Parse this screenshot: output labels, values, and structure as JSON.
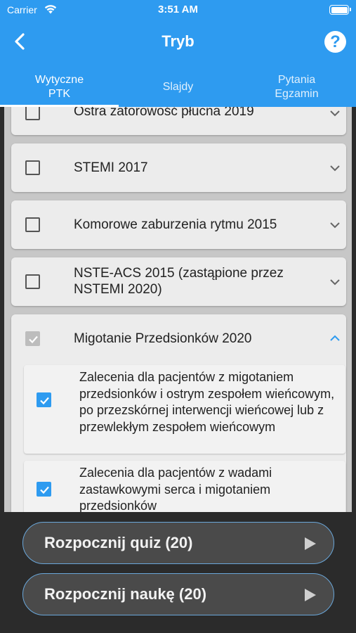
{
  "status": {
    "carrier": "Carrier",
    "time": "3:51 AM"
  },
  "nav": {
    "title": "Tryb",
    "help_label": "?"
  },
  "tabs": [
    {
      "label": "Wytyczne\nPTK",
      "active": true
    },
    {
      "label": "Slajdy",
      "active": false
    },
    {
      "label": "Pytania\nEgzamin",
      "active": false
    }
  ],
  "guidelines": [
    {
      "label": "Ostra zatorowość płucna 2019",
      "checked": false,
      "expanded": false
    },
    {
      "label": "STEMI 2017",
      "checked": false,
      "expanded": false
    },
    {
      "label": "Komorowe zaburzenia rytmu 2015",
      "checked": false,
      "expanded": false
    },
    {
      "label": "NSTE-ACS 2015 (zastąpione przez NSTEMI 2020)",
      "checked": false,
      "expanded": false
    },
    {
      "label": "Migotanie Przedsionków 2020",
      "checked": true,
      "expanded": true
    }
  ],
  "subitems": [
    {
      "label": "Zalecenia dla pacjentów z migotaniem przedsionków i ostrym zespołem wieńcowym, po przezskórnej interwencji wieńcowej lub z przewlekłym zespołem wieńcowym",
      "checked": true
    },
    {
      "label": "Zalecenia dla pacjentów z wadami zastawkowymi serca i migotaniem przedsionków",
      "checked": true
    }
  ],
  "actions": {
    "quiz_label": "Rozpocznij quiz (20)",
    "learn_label": "Rozpocznij naukę (20)"
  },
  "colors": {
    "accent": "#2e9bf0",
    "background": "#2b2b2b",
    "list_bg": "#c7c7c7"
  }
}
